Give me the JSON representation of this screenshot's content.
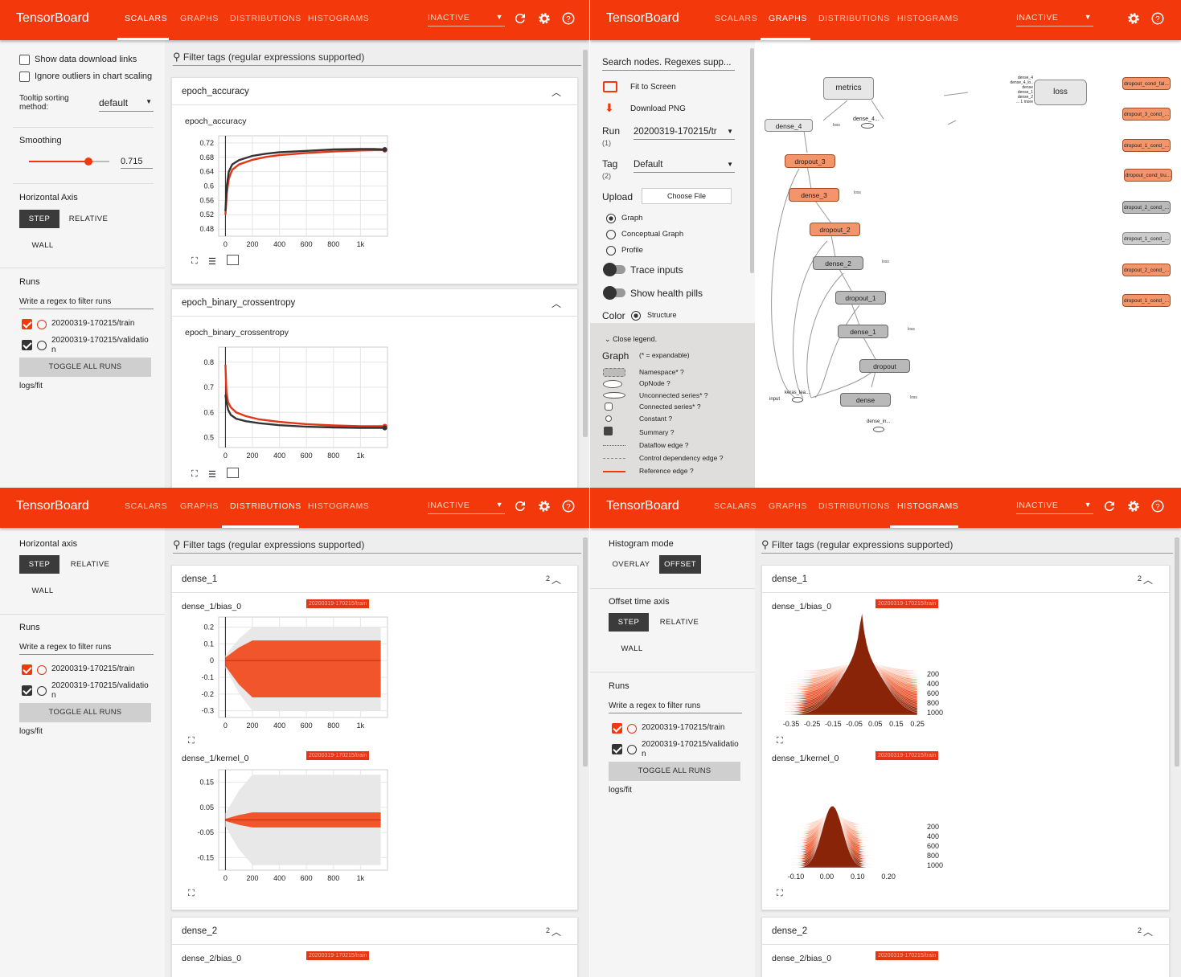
{
  "brand": "TensorBoard",
  "tabs": [
    "SCALARS",
    "GRAPHS",
    "DISTRIBUTIONS",
    "HISTOGRAMS"
  ],
  "inactive_label": "INACTIVE",
  "colors": {
    "accent": "#f3390b",
    "train": "#e53517",
    "validation": "#333333"
  },
  "scalars": {
    "options": {
      "show_download": "Show data download links",
      "ignore_outliers": "Ignore outliers in chart scaling",
      "tooltip_label": "Tooltip sorting method:",
      "tooltip_value": "default",
      "smoothing_label": "Smoothing",
      "smoothing_value": "0.715"
    },
    "axis": {
      "title": "Horizontal Axis",
      "step": "STEP",
      "relative": "RELATIVE",
      "wall": "WALL"
    },
    "runs": {
      "title": "Runs",
      "filter_placeholder": "Write a regex to filter runs",
      "run_train": "20200319-170215/train",
      "run_val_a": "20200319-170215/validatio",
      "run_val_b": "n",
      "toggle": "TOGGLE ALL RUNS",
      "logdir": "logs/fit"
    },
    "filter_tags": "Filter tags (regular expressions supported)",
    "cards": [
      {
        "title": "epoch_accuracy",
        "chart_title": "epoch_accuracy"
      },
      {
        "title": "epoch_binary_crossentropy",
        "chart_title": "epoch_binary_crossentropy"
      }
    ],
    "chart_icons": [
      "fullscreen-icon",
      "data-table-icon",
      "fit-domain-icon"
    ]
  },
  "graphs": {
    "search_placeholder": "Search nodes. Regexes supp...",
    "fit": "Fit to Screen",
    "download": "Download PNG",
    "run_label": "Run",
    "run_count": "(1)",
    "run_value": "20200319-170215/tr",
    "tag_label": "Tag",
    "tag_count": "(2)",
    "tag_value": "Default",
    "upload_label": "Upload",
    "choose_file": "Choose File",
    "modes": [
      "Graph",
      "Conceptual Graph",
      "Profile"
    ],
    "trace": "Trace inputs",
    "health": "Show health pills",
    "color_label": "Color",
    "color_value": "Structure",
    "legend_toggle": "Close legend.",
    "legend_title": "Graph",
    "legend_note": "(* = expandable)",
    "legend": [
      "Namespace* ?",
      "OpNode ?",
      "Unconnected series* ?",
      "Connected series* ?",
      "Constant ?",
      "Summary ?",
      "Dataflow edge ?",
      "Control dependency edge ?",
      "Reference edge ?"
    ],
    "nodes": {
      "metrics": "metrics",
      "loss": "loss",
      "dense_4": "dense_4",
      "dense_4b": "dense_4...",
      "dropout_3": "dropout_3",
      "dense_3": "dense_3",
      "dropout_2": "dropout_2",
      "dense_2": "dense_2",
      "dropout_1": "dropout_1",
      "dense_1": "dense_1",
      "dropout": "dropout",
      "dense": "dense",
      "input": "input",
      "keras_lea": "keras_lea...",
      "dense_in": "dense_in...",
      "loss_small": "loss",
      "more": "... 1 more"
    },
    "loss_inputs": [
      "dense_4",
      "dense_4_lo..",
      "dense",
      "dense_1",
      "dense_2"
    ],
    "side_nodes": [
      "dropout_cond_fal...",
      "dropout_3_cond_...",
      "dropout_1_cond_...",
      "dropout_cond_tru...",
      "dropout_2_cond_...",
      "dropout_1_cond_...",
      "dropout_2_cond_...",
      "dropout_1_cond_..."
    ]
  },
  "distributions": {
    "axis": {
      "title": "Horizontal axis",
      "step": "STEP",
      "relative": "RELATIVE",
      "wall": "WALL"
    },
    "runs": {
      "title": "Runs",
      "filter_placeholder": "Write a regex to filter runs",
      "run_train": "20200319-170215/train",
      "run_val_a": "20200319-170215/validatio",
      "run_val_b": "n",
      "toggle": "TOGGLE ALL RUNS",
      "logdir": "logs/fit"
    },
    "filter_tags": "Filter tags (regular expressions supported)",
    "groups": [
      {
        "title": "dense_1",
        "count": "2"
      },
      {
        "title": "dense_2",
        "count": "2"
      }
    ],
    "charts": [
      {
        "title": "dense_1/bias_0",
        "run": "20200319-170215/train"
      },
      {
        "title": "dense_1/kernel_0",
        "run": "20200319-170215/train"
      },
      {
        "title": "dense_2/bias_0",
        "run": "20200319-170215/train"
      }
    ]
  },
  "histograms": {
    "mode_label": "Histogram mode",
    "overlay": "OVERLAY",
    "offset": "OFFSET",
    "offset_label": "Offset time axis",
    "step": "STEP",
    "relative": "RELATIVE",
    "wall": "WALL",
    "runs": {
      "title": "Runs",
      "filter_placeholder": "Write a regex to filter runs",
      "run_train": "20200319-170215/train",
      "run_val_a": "20200319-170215/validatio",
      "run_val_b": "n",
      "toggle": "TOGGLE ALL RUNS",
      "logdir": "logs/fit"
    },
    "filter_tags": "Filter tags (regular expressions supported)",
    "groups": [
      {
        "title": "dense_1",
        "count": "2"
      },
      {
        "title": "dense_2",
        "count": "2"
      }
    ],
    "charts": [
      {
        "title": "dense_1/bias_0",
        "run": "20200319-170215/train"
      },
      {
        "title": "dense_1/kernel_0",
        "run": "20200319-170215/train"
      },
      {
        "title": "dense_2/bias_0",
        "run": "20200319-170215/train"
      }
    ]
  },
  "chart_data": [
    {
      "type": "line",
      "title": "epoch_accuracy",
      "x_ticks": [
        "0",
        "200",
        "400",
        "600",
        "800",
        "1k"
      ],
      "y_ticks": [
        "0.72",
        "0.68",
        "0.64",
        "0.6",
        "0.56",
        "0.52",
        "0.48"
      ],
      "xlim": [
        -50,
        1200
      ],
      "ylim": [
        0.46,
        0.74
      ],
      "series": [
        {
          "color": "#e53517",
          "x": [
            0,
            10,
            25,
            50,
            100,
            200,
            300,
            400,
            600,
            800,
            1000,
            1100,
            1180
          ],
          "y": [
            0.52,
            0.58,
            0.62,
            0.645,
            0.66,
            0.673,
            0.681,
            0.686,
            0.692,
            0.696,
            0.699,
            0.7,
            0.7
          ]
        },
        {
          "color": "#333333",
          "x": [
            0,
            10,
            25,
            50,
            100,
            200,
            300,
            400,
            600,
            800,
            1000,
            1100,
            1180
          ],
          "y": [
            0.53,
            0.6,
            0.64,
            0.66,
            0.672,
            0.684,
            0.69,
            0.694,
            0.698,
            0.702,
            0.703,
            0.703,
            0.702
          ]
        }
      ]
    },
    {
      "type": "line",
      "title": "epoch_binary_crossentropy",
      "x_ticks": [
        "0",
        "200",
        "400",
        "600",
        "800",
        "1k"
      ],
      "y_ticks": [
        "0.8",
        "0.7",
        "0.6",
        "0.5"
      ],
      "xlim": [
        -50,
        1200
      ],
      "ylim": [
        0.46,
        0.86
      ],
      "series": [
        {
          "color": "#e53517",
          "x": [
            0,
            8,
            20,
            40,
            80,
            150,
            250,
            400,
            600,
            800,
            1000,
            1180
          ],
          "y": [
            0.79,
            0.68,
            0.64,
            0.62,
            0.6,
            0.585,
            0.572,
            0.562,
            0.553,
            0.548,
            0.545,
            0.545
          ]
        },
        {
          "color": "#333333",
          "x": [
            0,
            8,
            20,
            40,
            80,
            150,
            250,
            400,
            600,
            800,
            1000,
            1180
          ],
          "y": [
            0.67,
            0.64,
            0.61,
            0.59,
            0.575,
            0.565,
            0.557,
            0.549,
            0.543,
            0.54,
            0.538,
            0.538
          ]
        }
      ]
    },
    {
      "type": "area",
      "title": "dense_1/bias_0",
      "x_ticks": [
        "0",
        "200",
        "400",
        "600",
        "800",
        "1k"
      ],
      "y_ticks": [
        "0.2",
        "0.1",
        "0",
        "-0.1",
        "-0.2",
        "-0.3"
      ],
      "xlim": [
        -50,
        1200
      ],
      "ylim": [
        -0.34,
        0.26
      ],
      "outer": [
        0.2,
        -0.3
      ],
      "inner": [
        0.12,
        -0.22
      ]
    },
    {
      "type": "area",
      "title": "dense_1/kernel_0",
      "x_ticks": [
        "0",
        "200",
        "400",
        "600",
        "800",
        "1k"
      ],
      "y_ticks": [
        "0.15",
        "0.05",
        "-0.05",
        "-0.15"
      ],
      "xlim": [
        -50,
        1200
      ],
      "ylim": [
        -0.2,
        0.2
      ],
      "outer": [
        0.18,
        -0.18
      ],
      "inner": [
        0.03,
        -0.03
      ]
    },
    {
      "type": "histogram",
      "title": "dense_1/bias_0",
      "x_ticks": [
        "-0.35",
        "-0.25",
        "-0.15",
        "-0.05",
        "0.05",
        "0.15",
        "0.25"
      ],
      "steps": [
        "200",
        "400",
        "600",
        "800",
        "1000"
      ]
    },
    {
      "type": "histogram",
      "title": "dense_1/kernel_0",
      "x_ticks": [
        "-0.10",
        "0.00",
        "0.10",
        "0.20"
      ],
      "steps": [
        "200",
        "400",
        "600",
        "800",
        "1000"
      ]
    }
  ]
}
